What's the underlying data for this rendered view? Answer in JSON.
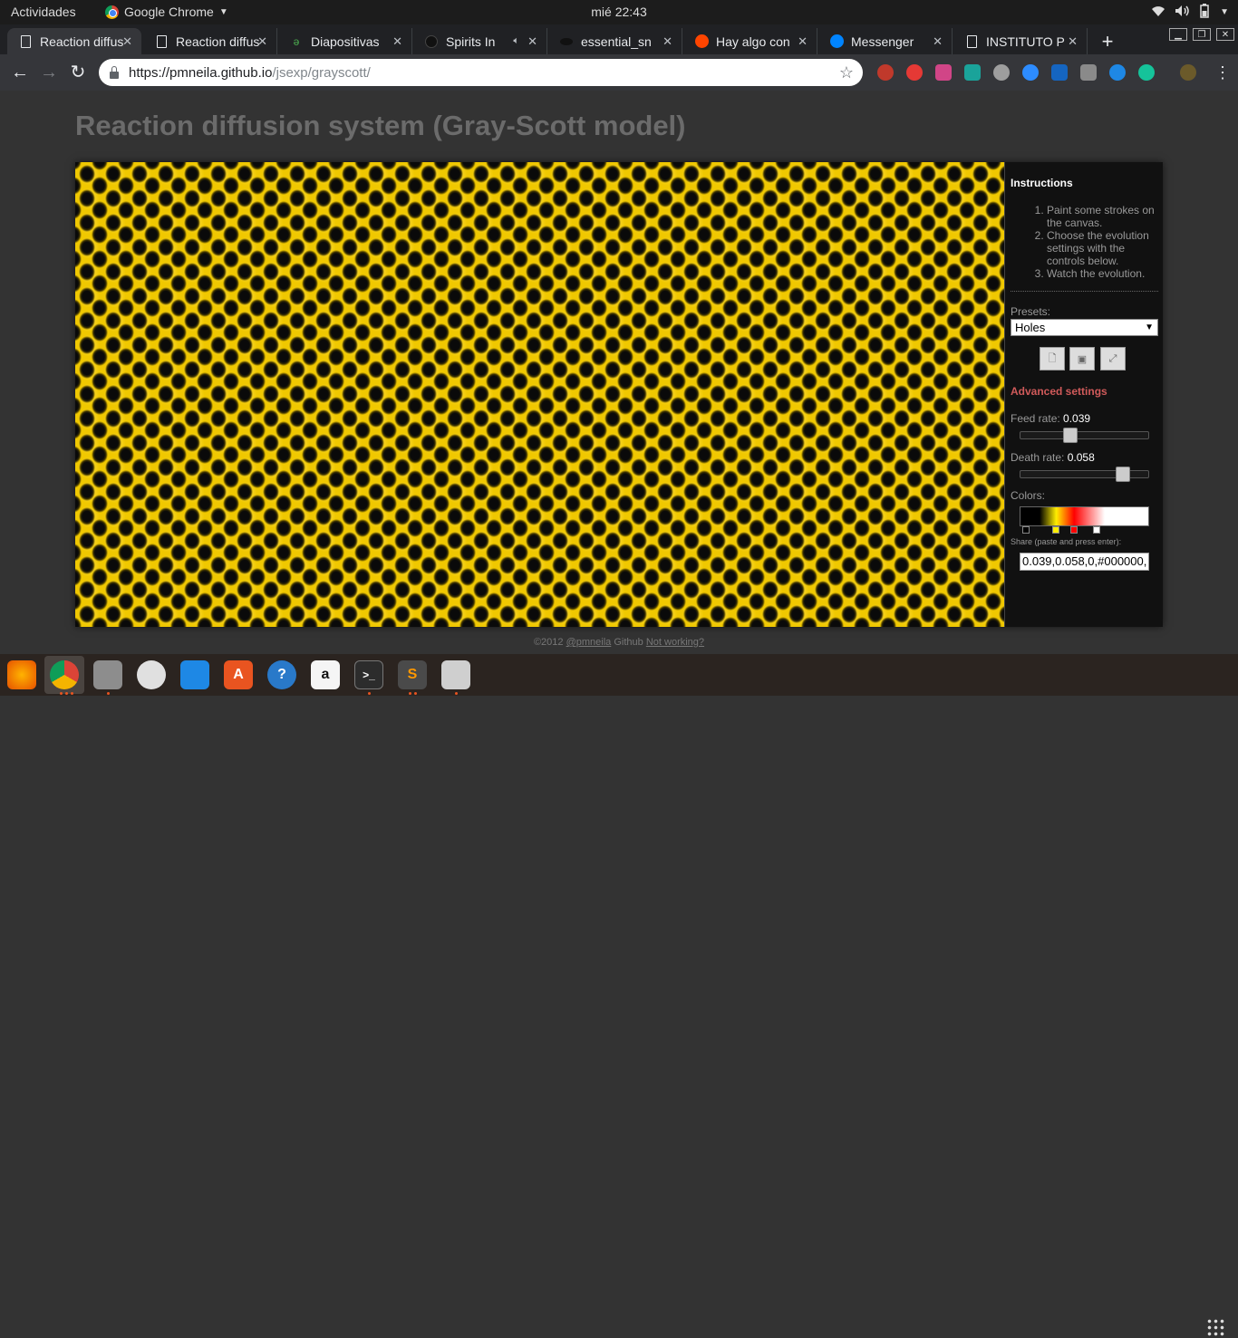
{
  "topbar": {
    "activities": "Actividades",
    "app_name": "Google Chrome",
    "clock": "mié 22:43"
  },
  "tabs": [
    {
      "label": "Reaction diffusion",
      "icon": "document-icon",
      "active": true
    },
    {
      "label": "Reaction diffusion",
      "icon": "document-icon"
    },
    {
      "label": "Diapositivas",
      "icon": "diapositivas-icon"
    },
    {
      "label": "Spirits In",
      "icon": "spirits-icon"
    },
    {
      "label": "essential_sn",
      "icon": "essential-icon"
    },
    {
      "label": "Hay algo con",
      "icon": "reddit-icon"
    },
    {
      "label": "Messenger",
      "icon": "messenger-icon"
    },
    {
      "label": "INSTITUTO P",
      "icon": "document-icon"
    }
  ],
  "address_bar": {
    "url_host": "https://pmneila.github.io",
    "url_path": "/jsexp/grayscott/"
  },
  "page": {
    "title": "Reaction diffusion system (Gray-Scott model)",
    "instructions": {
      "title": "Instructions",
      "steps": [
        "Paint some strokes on the canvas.",
        "Choose the evolution settings with the controls below.",
        "Watch the evolution."
      ]
    },
    "presets_label": "Presets:",
    "preset_value": "Holes",
    "advanced_label": "Advanced settings",
    "feed_label": "Feed rate:",
    "feed_value": "0.039",
    "feed_fraction": 0.39,
    "death_label": "Death rate:",
    "death_value": "0.058",
    "death_fraction": 0.8,
    "colors_label": "Colors:",
    "color_stops": [
      "#000000",
      "#ffee00",
      "#ff0000",
      "#ffffff"
    ],
    "share_label": "Share (paste and press enter):",
    "share_value": "0.039,0.058,0,#000000,",
    "footer": {
      "copyright": "©2012",
      "author": "@pmneila",
      "github": "Github",
      "not_working": "Not working?"
    }
  },
  "colors": {
    "pattern_yellow": "#f0c800",
    "pattern_dark": "#0a0a0a",
    "advanced_red": "#d05a5a",
    "dock_accent": "#e95420"
  }
}
